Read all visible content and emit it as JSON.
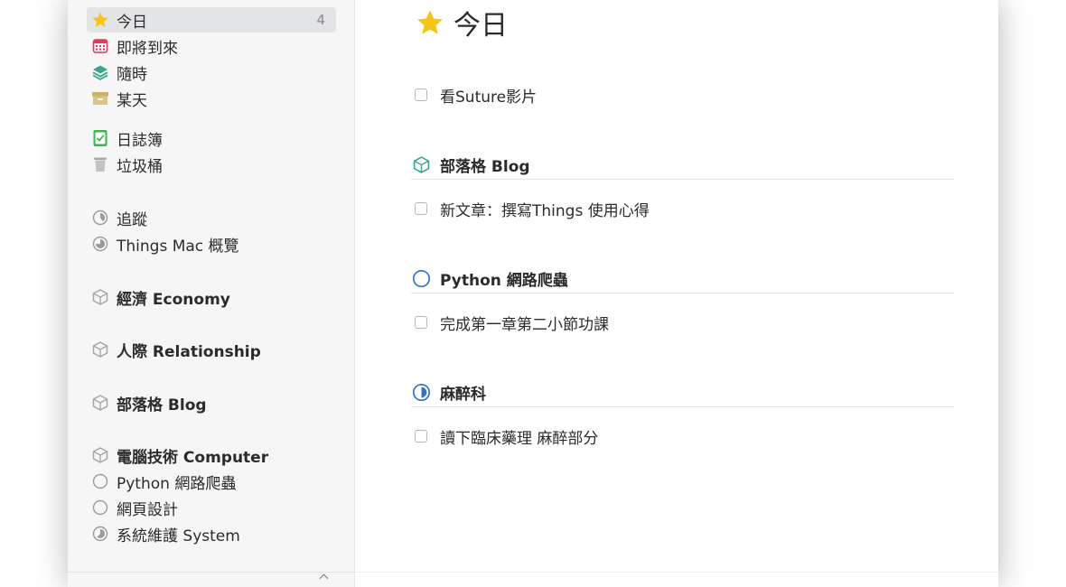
{
  "sidebar": {
    "items": [
      {
        "label": "今日",
        "count": "4",
        "icon": "star-icon"
      },
      {
        "label": "即將到來",
        "icon": "calendar-icon"
      },
      {
        "label": "隨時",
        "icon": "layers-icon"
      },
      {
        "label": "某天",
        "icon": "archive-box-icon"
      },
      {
        "label": "日誌簿",
        "icon": "logbook-icon"
      },
      {
        "label": "垃圾桶",
        "icon": "trash-icon"
      },
      {
        "label": "追蹤",
        "icon": "progress-pie-icon"
      },
      {
        "label": "Things Mac 概覽",
        "icon": "progress-pie-icon"
      },
      {
        "label": "經濟 Economy",
        "icon": "area-cube-icon"
      },
      {
        "label": "人際 Relationship",
        "icon": "area-cube-icon"
      },
      {
        "label": "部落格 Blog",
        "icon": "area-cube-icon"
      },
      {
        "label": "電腦技術 Computer",
        "icon": "area-cube-icon"
      },
      {
        "label": "Python 網路爬蟲",
        "icon": "empty-circle-icon"
      },
      {
        "label": "網頁設計",
        "icon": "empty-circle-icon"
      },
      {
        "label": "系統維護 System",
        "icon": "progress-pie-icon"
      }
    ]
  },
  "main": {
    "title": "今日",
    "tasks": [
      {
        "label": "看Suture影片"
      },
      {
        "label": "新文章：撰寫Things 使用心得"
      },
      {
        "label": "完成第一章第二小節功課"
      },
      {
        "label": "讀下臨床藥理 麻醉部分"
      }
    ],
    "groups": [
      {
        "label": "部落格 Blog",
        "icon": "area-cube-icon"
      },
      {
        "label": "Python 網路爬蟲",
        "icon": "empty-circle-icon"
      },
      {
        "label": "麻醉科",
        "icon": "half-pie-icon"
      }
    ]
  },
  "colors": {
    "star": "#f5c518",
    "calendar": "#e8365d",
    "layers": "#3aa58e",
    "someday": "#c9b26a",
    "logbook": "#3fb34f",
    "project_blue": "#2f6fd1"
  }
}
